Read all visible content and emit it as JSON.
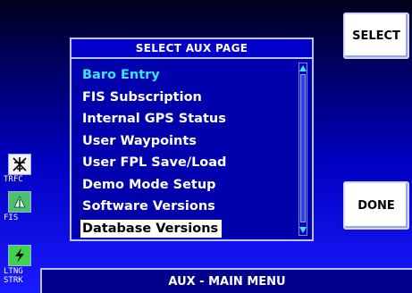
{
  "softkeys": {
    "select": "SELECT",
    "done": "DONE"
  },
  "dialog": {
    "title": "SELECT AUX PAGE",
    "items": [
      "Baro Entry",
      "FIS Subscription",
      "Internal GPS Status",
      "User Waypoints",
      "User FPL Save/Load",
      "Demo Mode Setup",
      "Software Versions",
      "Database Versions"
    ],
    "selected_index": 7
  },
  "side": {
    "trfc_label": "TRFC",
    "fis_label": "FIS",
    "ltng_label": "LTNG",
    "strk_label": "STRK"
  },
  "bottom_bar": {
    "label": "AUX - MAIN MENU"
  },
  "colors": {
    "accent_cyan": "#3fe2ff",
    "panel_blue": "#0000ac",
    "highlight": "#ffffff"
  }
}
